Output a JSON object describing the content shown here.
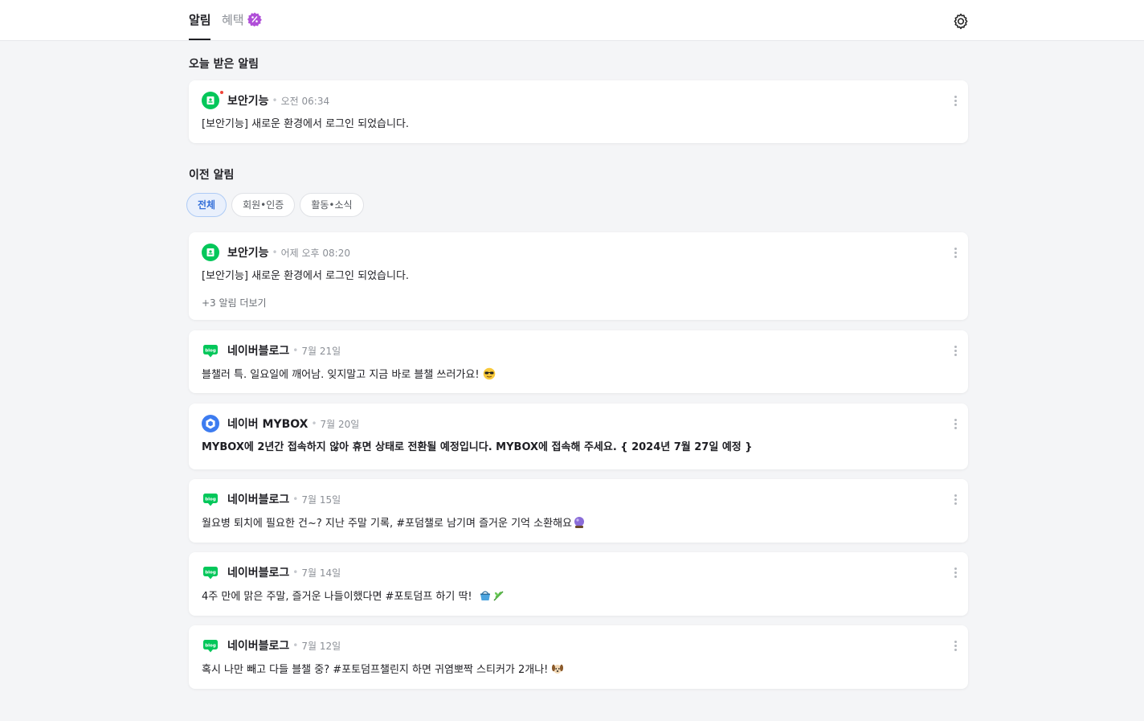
{
  "tabs": {
    "alarm": "알림",
    "benefit": "혜택"
  },
  "icons": {
    "settings": "gear-icon",
    "benefit_badge": "percent-badge-icon",
    "more": "kebab-menu-icon"
  },
  "colors": {
    "naver_green": "#03c75a",
    "mybox_blue": "#3d7cf0",
    "unread_red": "#f0443a",
    "chip_active": "#3470d9"
  },
  "today": {
    "title": "오늘 받은 알림",
    "item": {
      "source": "보안기능",
      "time": "오전 06:34",
      "message": "[보안기능] 새로운 환경에서 로그인 되었습니다."
    }
  },
  "previous": {
    "title": "이전 알림",
    "filters": [
      "전체",
      "회원•인증",
      "활동•소식"
    ],
    "selected_filter": "전체",
    "items": [
      {
        "source": "보안기능",
        "time": "어제 오후 08:20",
        "message": "[보안기능] 새로운 환경에서 로그인 되었습니다.",
        "more": "+3 알림 더보기"
      },
      {
        "source": "네이버블로그",
        "time": "7월 21일",
        "message": "블챌러 특. 일요일에 깨어남. 잊지말고 지금 바로 블챌 쓰러가요!"
      },
      {
        "source": "네이버 MYBOX",
        "time": "7월 20일",
        "message": "MYBOX에 2년간 접속하지 않아 휴면 상태로 전환될 예정입니다. MYBOX에 접속해 주세요. { 2024년 7월 27일 예정 }"
      },
      {
        "source": "네이버블로그",
        "time": "7월 15일",
        "message": "월요병 퇴치에 필요한 건~?￼ 지난 주말 기록, #포덤챌로 남기며 즐거운 기억 소환해요"
      },
      {
        "source": "네이버블로그",
        "time": "7월 14일",
        "message": "4주 만에 맑은 주말, 즐거운 나들이했다면 #포토덤프 하기 딱!"
      },
      {
        "source": "네이버블로그",
        "time": "7월 12일",
        "message": "혹시 나만 빼고 다들 블챌 중? #포토덤프챌린지 하면 귀염뽀짝 스티커가 2개나!"
      }
    ]
  },
  "blog_icon_text": "blog"
}
